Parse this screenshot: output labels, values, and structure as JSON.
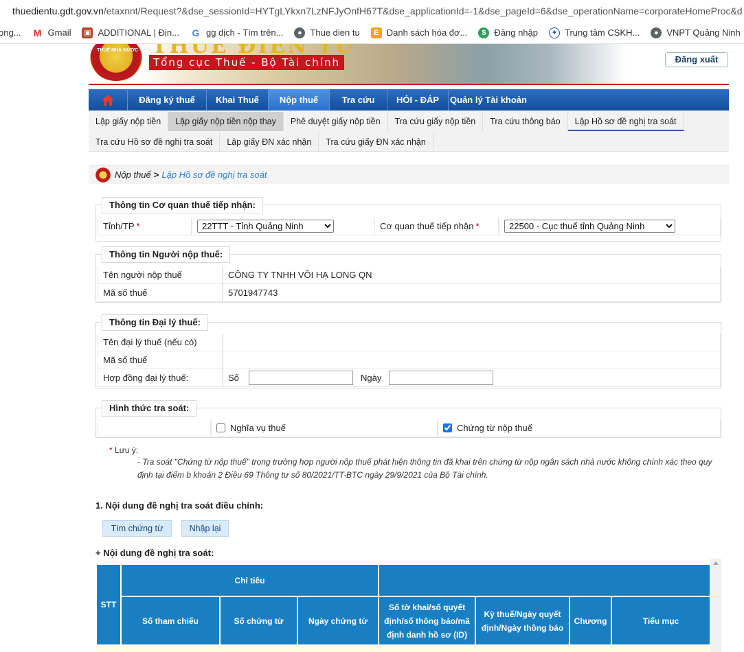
{
  "browser": {
    "url_host": "thuedientu.gdt.gov.vn",
    "url_path": "/etaxnnt/Request?&dse_sessionId=HYTgLYkxn7LzNFJyOnfH67T&dse_applicationId=-1&dse_pageId=6&dse_operationName=corporateHomeProc&d",
    "bookmarks": [
      {
        "label": "ong...",
        "icon": "bookmark-icon"
      },
      {
        "label": "Gmail",
        "icon": "gmail-icon"
      },
      {
        "label": "ADDITIONAL | Địn...",
        "icon": "shield-crest-icon"
      },
      {
        "label": "gg dịch - Tìm trên...",
        "icon": "google-icon"
      },
      {
        "label": "Thue dien tu",
        "icon": "globe-icon"
      },
      {
        "label": "Danh sách hóa đơ...",
        "icon": "e-invoice-icon"
      },
      {
        "label": "Đăng nhập",
        "icon": "dollar-icon"
      },
      {
        "label": "Trung tâm CSKH...",
        "icon": "power-icon"
      },
      {
        "label": "VNPT Quảng Ninh",
        "icon": "globe-icon"
      }
    ]
  },
  "header": {
    "emblem_text": "THUẾ NHÀ NƯỚC",
    "title": "THUẾ ĐIỆN TỬ",
    "subtitle": "Tổng cục Thuế - Bộ Tài chính",
    "logout": "Đăng xuất"
  },
  "main_nav": [
    {
      "label": "Đăng ký thuế",
      "active": false
    },
    {
      "label": "Khai Thuế",
      "active": false
    },
    {
      "label": "Nộp thuế",
      "active": true
    },
    {
      "label": "Tra cứu",
      "active": false
    },
    {
      "label": "HỎI - ĐÁP",
      "active": false
    },
    {
      "label": "Quản lý Tài khoản",
      "active": false
    }
  ],
  "sub_nav_row1": [
    "Lập giấy nộp tiền",
    "Lập giấy nộp tiền nộp thay",
    "Phê duyệt giấy nộp tiền",
    "Tra cứu giấy nộp tiền",
    "Tra cứu thông báo",
    "Lập Hồ sơ đề nghị tra soát"
  ],
  "sub_nav_row2": [
    "Tra cứu Hồ sơ đề nghị tra soát",
    "Lập giấy ĐN xác nhận",
    "Tra cứu giấy ĐN xác nhận"
  ],
  "breadcrumb": {
    "parent": "Nộp thuế",
    "separator": ">",
    "current": "Lập Hồ sơ đề nghị tra soát"
  },
  "section_agency": {
    "legend": "Thông tin Cơ quan thuế tiếp nhận:",
    "province_label": "Tỉnh/TP",
    "province_value": "22TTT - Tỉnh Quảng Ninh",
    "agency_label": "Cơ quan thuế tiếp nhận",
    "agency_value": "22500 - Cục thuế tỉnh Quảng Ninh",
    "required_mark": "*"
  },
  "section_taxpayer": {
    "legend": "Thông tin Người nộp thuế:",
    "name_label": "Tên người nộp thuế",
    "name_value": "CÔNG TY TNHH VÔI HẠ LONG QN",
    "tax_code_label": "Mã số thuế",
    "tax_code_value": "5701947743"
  },
  "section_agent": {
    "legend": "Thông tin Đại lý thuế:",
    "name_label": "Tên đại lý thuế (nếu có)",
    "tax_code_label": "Mã số thuế",
    "contract_label": "Hợp đồng đại lý thuế:",
    "number_label": "Số",
    "date_label": "Ngày"
  },
  "section_method": {
    "legend": "Hình thức tra soát:",
    "option1": "Nghĩa vụ thuế",
    "option1_checked": false,
    "option2": "Chứng từ nộp thuế",
    "option2_checked": true
  },
  "note": {
    "star": "*",
    "title": "Lưu ý:",
    "line1": "- Tra soát \"Chứng từ nộp thuế\" trong trường hợp người nộp thuế phát hiện thông tin đã khai trên chứng từ nộp ngân sách nhà nước không chính xác theo quy",
    "line2": "định tại điểm b khoản 2 Điều 69 Thông tư số 80/2021/TT-BTC ngày 29/9/2021 của Bộ Tài chính."
  },
  "content": {
    "heading": "1. Nội dung đề nghị tra soát điều chỉnh:",
    "search_button": "Tìm chứng từ",
    "reset_button": "Nhập lại",
    "subheading": "+ Nội dung đề nghị tra soát:"
  },
  "table": {
    "stt": "STT",
    "group": "Chỉ tiêu",
    "columns": [
      "Số tham chiếu",
      "Số chứng từ",
      "Ngày chứng từ",
      "Số tờ khai/số quyết định/số thông báo/mã định danh hồ sơ (ID)",
      "Kỳ thuế/Ngày quyết định/Ngày thông báo",
      "Chương",
      "Tiểu mục"
    ]
  },
  "colors": {
    "nav_blue": "#124f9c",
    "table_header": "#1a7fc2",
    "accent_red": "#c8161d"
  }
}
